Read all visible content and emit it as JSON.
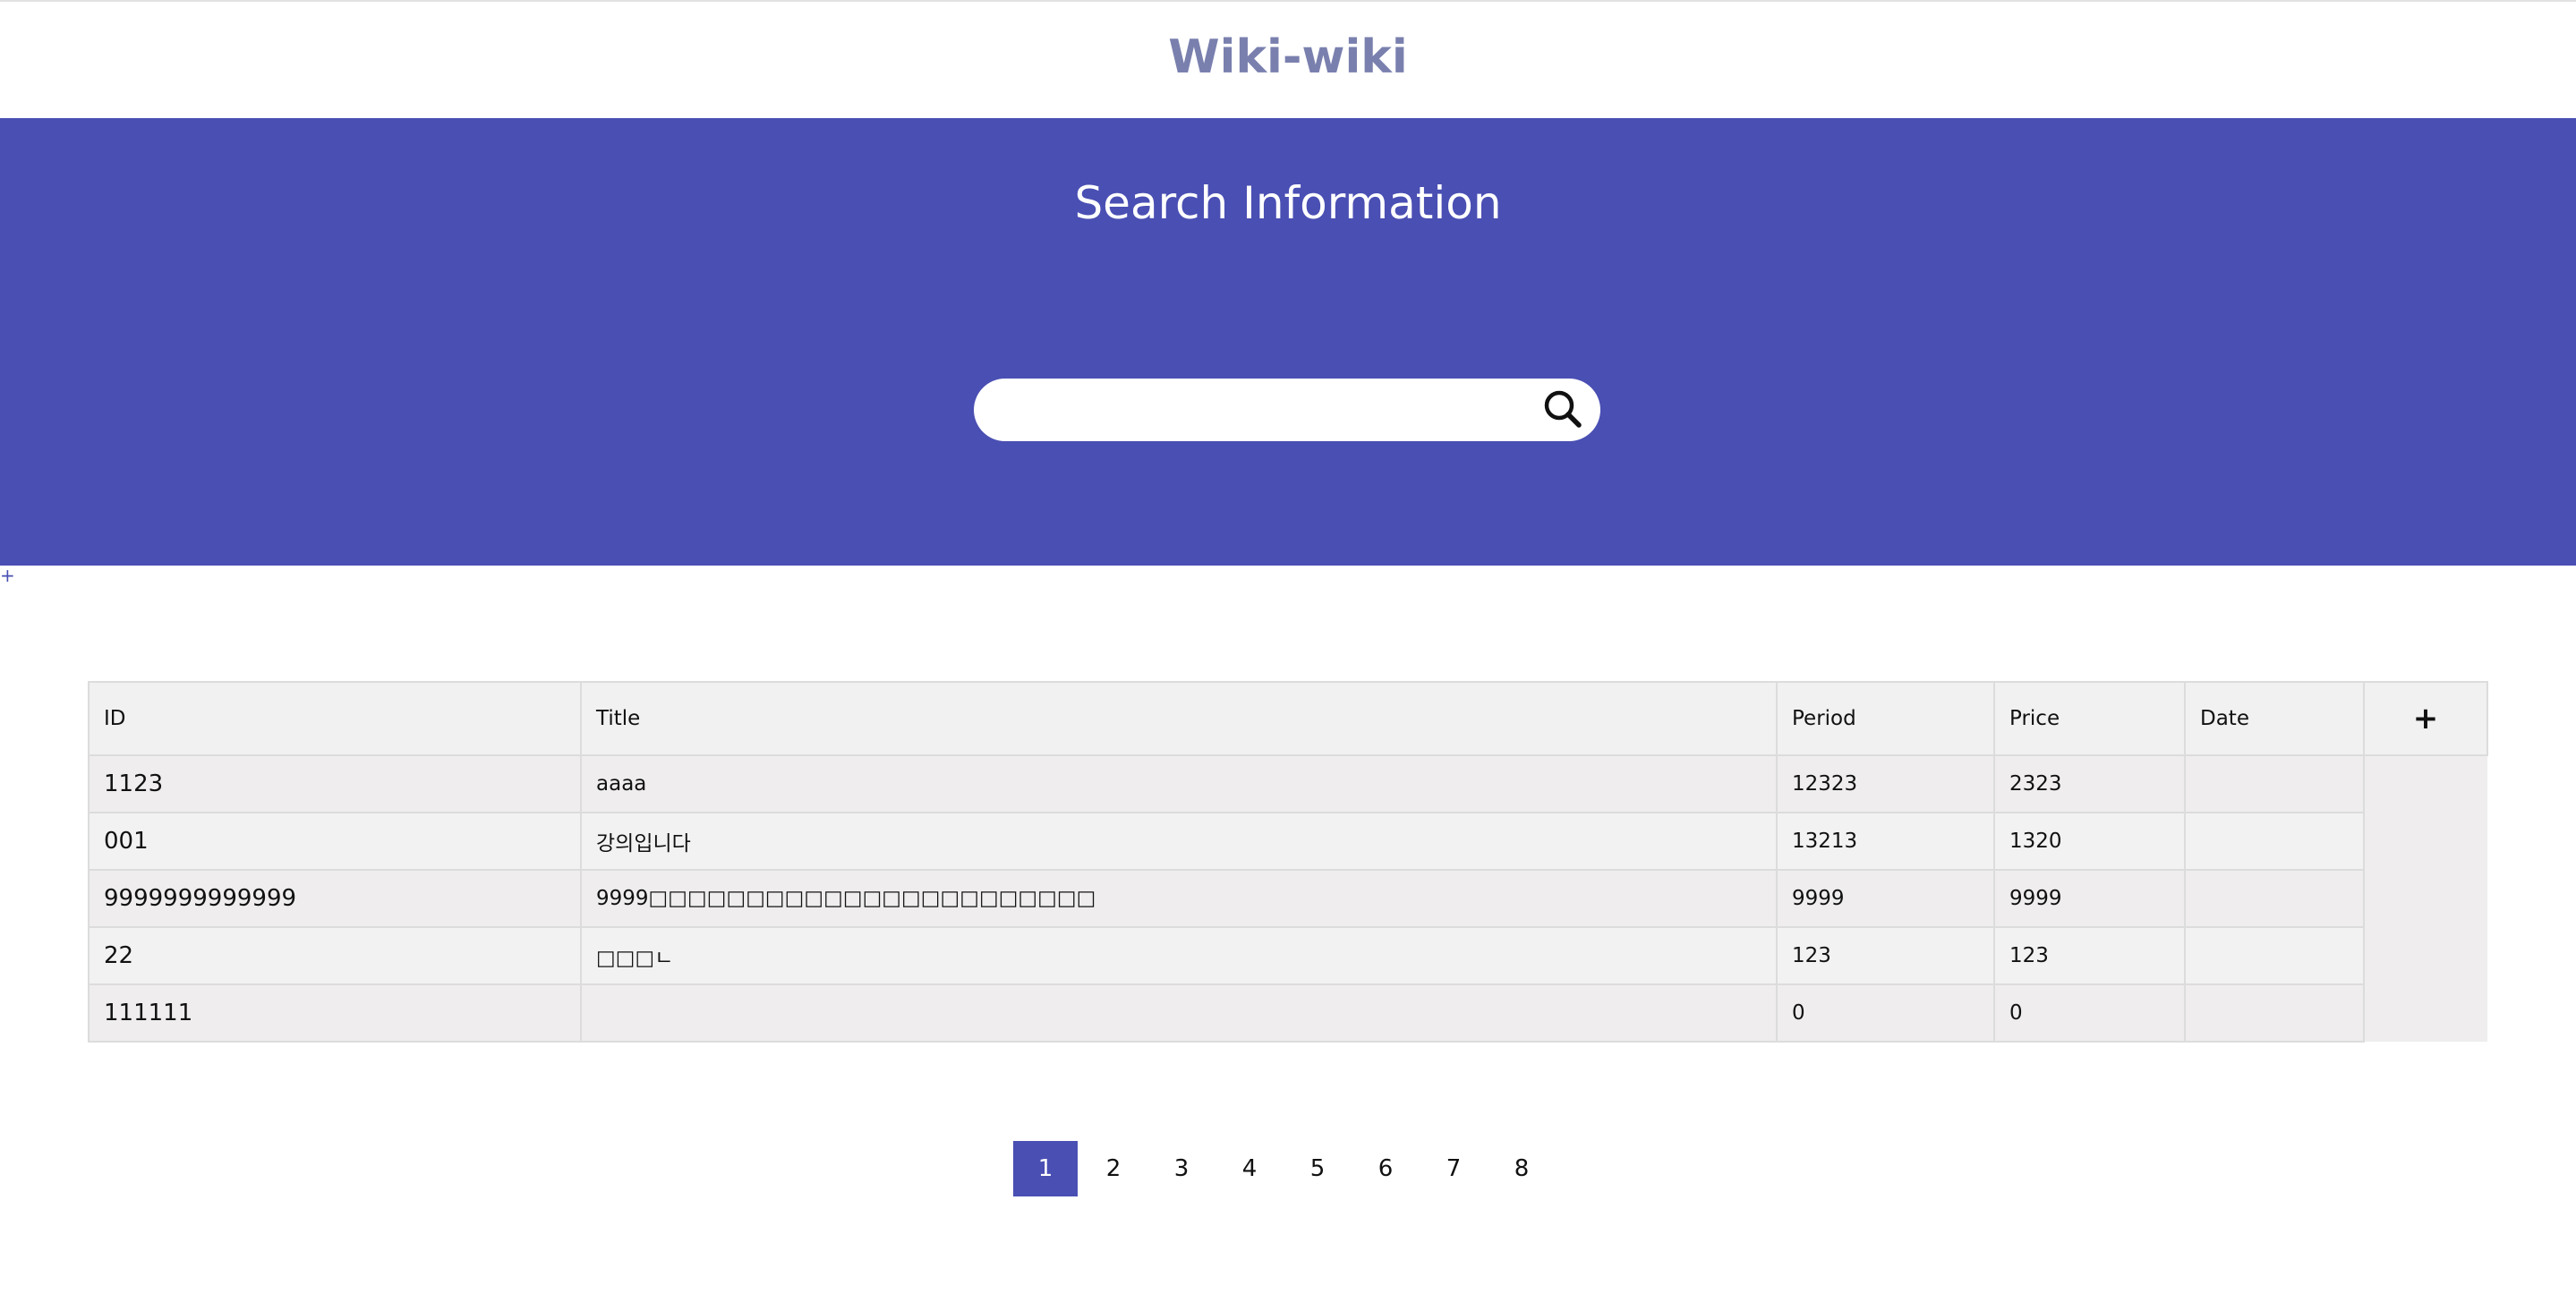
{
  "header": {
    "site_title": "Wiki-wiki"
  },
  "hero": {
    "title": "Search Information"
  },
  "search": {
    "placeholder": "",
    "value": "",
    "icon": "search-icon"
  },
  "extra": {
    "plus_symbol": "+"
  },
  "table": {
    "columns": [
      "ID",
      "Title",
      "Period",
      "Price",
      "Date"
    ],
    "add_label": "+",
    "rows": [
      {
        "id": "1123",
        "title": "aaaa",
        "period": "12323",
        "price": "2323",
        "date": ""
      },
      {
        "id": "001",
        "title": "강의입니다",
        "period": "13213",
        "price": "1320",
        "date": ""
      },
      {
        "id": "9999999999999",
        "title": "9999□□□□□□□□□□□□□□□□□□□□□□□",
        "period": "9999",
        "price": "9999",
        "date": ""
      },
      {
        "id": "22",
        "title": "□□□ㄴ",
        "period": "123",
        "price": "123",
        "date": ""
      },
      {
        "id": "111111",
        "title": "",
        "period": "0",
        "price": "0",
        "date": ""
      }
    ]
  },
  "pagination": {
    "pages": [
      "1",
      "2",
      "3",
      "4",
      "5",
      "6",
      "7",
      "8"
    ],
    "active_page": "1"
  },
  "colors": {
    "accent": "#4a4fb3",
    "title": "#7a80ae",
    "table_header": "#f1f1f1",
    "border": "#dcdcdc"
  }
}
